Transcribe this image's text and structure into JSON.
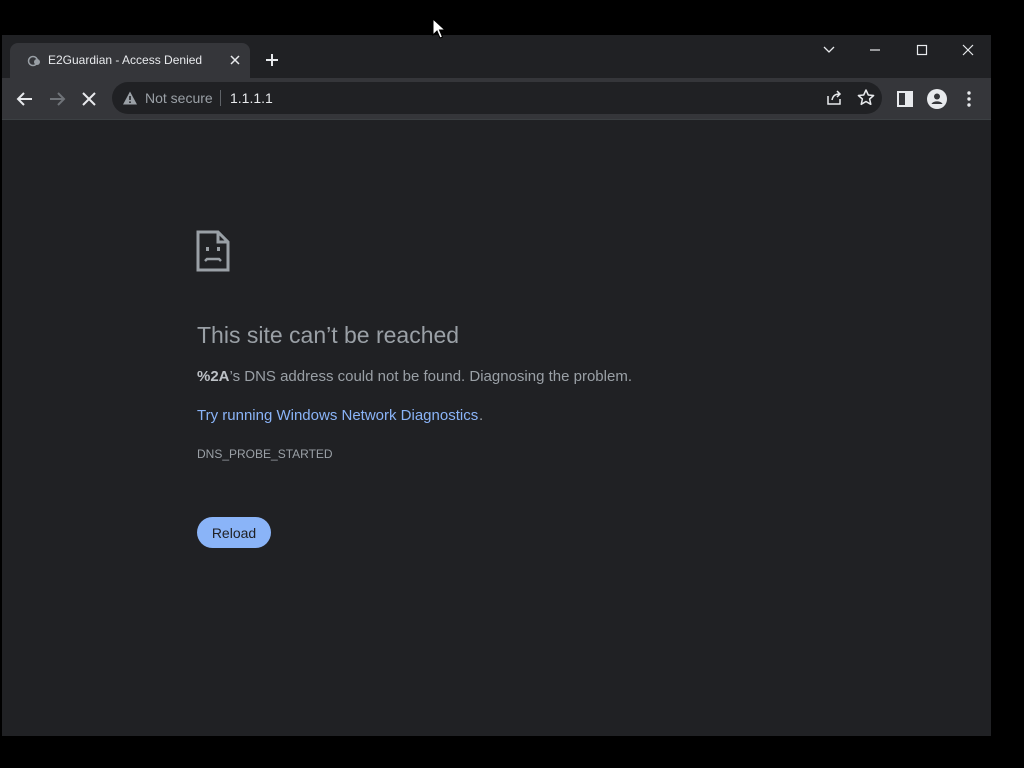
{
  "browser": {
    "tab": {
      "title": "E2Guardian - Access Denied",
      "favicon": "e2guardian-icon"
    },
    "address": {
      "security_label": "Not secure",
      "url": "1.1.1.1"
    },
    "icons": {
      "back": "arrow-left-icon",
      "forward": "arrow-right-icon",
      "stop": "close-icon",
      "share": "share-icon",
      "bookmark": "star-icon",
      "sidepanel": "side-panel-icon",
      "profile": "profile-icon",
      "menu": "kebab-menu-icon"
    }
  },
  "error": {
    "heading": "This site can’t be reached",
    "host": "%2A",
    "message_rest": "’s DNS address could not be found. Diagnosing the problem.",
    "suggestion_link": "Try running Windows Network Diagnostics",
    "suggestion_end": ".",
    "error_code": "DNS_PROBE_STARTED",
    "reload_label": "Reload"
  },
  "colors": {
    "background": "#202124",
    "toolbar": "#35363a",
    "link": "#8ab4f8",
    "text": "#9aa0a6"
  }
}
